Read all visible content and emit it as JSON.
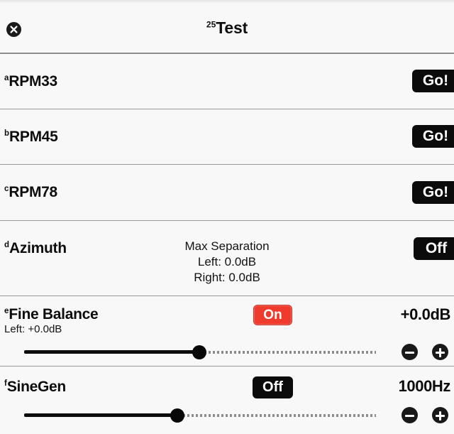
{
  "header": {
    "title_superscript": "25",
    "title": "Test",
    "close_icon": "close-circle-icon"
  },
  "rows": [
    {
      "key": "rpm33",
      "superscript": "a",
      "label": "RPM33",
      "action_label": "Go!"
    },
    {
      "key": "rpm45",
      "superscript": "b",
      "label": "RPM45",
      "action_label": "Go!"
    },
    {
      "key": "rpm78",
      "superscript": "c",
      "label": "RPM78",
      "action_label": "Go!"
    },
    {
      "key": "azimuth",
      "superscript": "d",
      "label": "Azimuth",
      "action_label": "Off",
      "info_line_1": "Max Separation",
      "info_line_2": "Left: 0.0dB",
      "info_line_3": "Right: 0.0dB"
    },
    {
      "key": "fine_balance",
      "superscript": "e",
      "label": "Fine Balance",
      "toggle_label": "On",
      "toggle_state": "on",
      "toggle_color": "#ee3b2e",
      "value": "+0.0dB",
      "sub_label": "Left: +0.0dB",
      "slider": {
        "fill_percent": 50,
        "decrement_icon": "minus-circle-icon",
        "increment_icon": "plus-circle-icon"
      }
    },
    {
      "key": "sinegen",
      "superscript": "f",
      "label": "SineGen",
      "toggle_label": "Off",
      "toggle_state": "off",
      "toggle_color": "#0b0b0b",
      "value": "1000Hz",
      "slider": {
        "fill_percent": 43,
        "decrement_icon": "minus-circle-icon",
        "increment_icon": "plus-circle-icon"
      }
    }
  ]
}
